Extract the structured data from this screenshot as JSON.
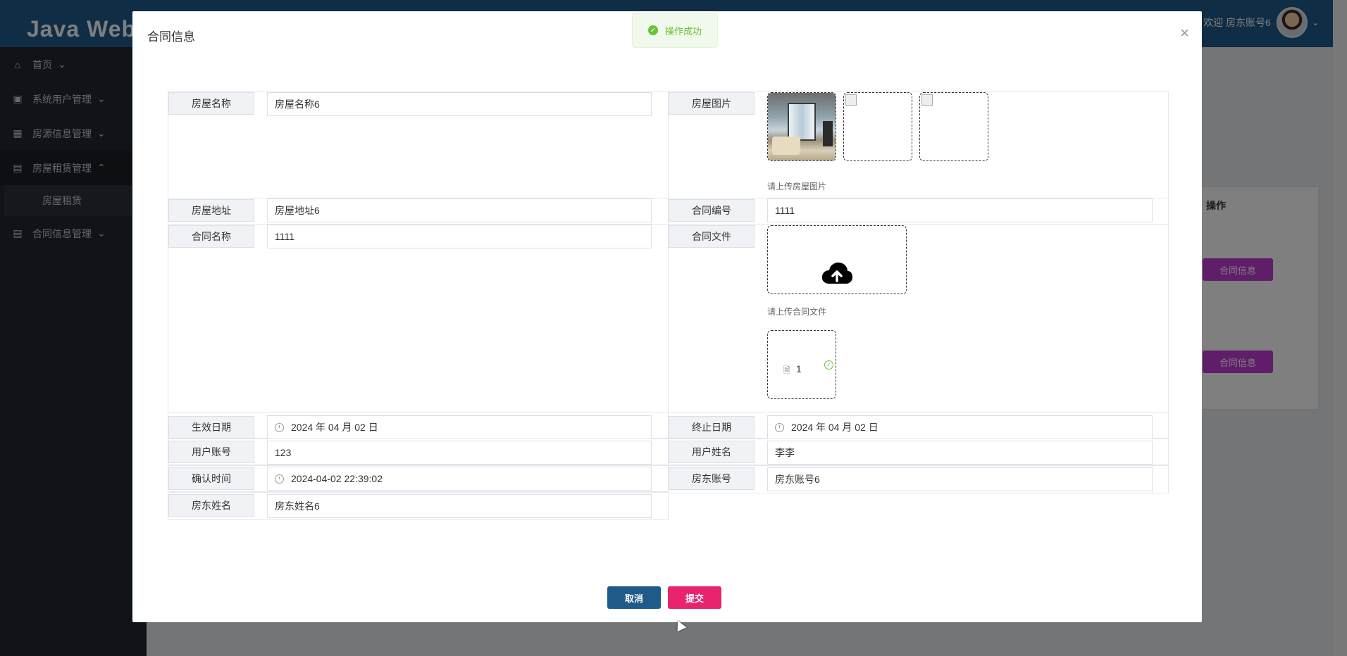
{
  "app": {
    "brand": "Java Web的",
    "welcome": "欢迎 房东账号6"
  },
  "sidebar": {
    "items": [
      {
        "icon": "home-icon",
        "glyph": "⌂",
        "label": "首页",
        "arrow": "⌄"
      },
      {
        "icon": "user-card-icon",
        "glyph": "▣",
        "label": "系统用户管理",
        "arrow": "⌄"
      },
      {
        "icon": "grid-icon",
        "glyph": "▦",
        "label": "房源信息管理",
        "arrow": "⌄"
      },
      {
        "icon": "table-icon",
        "glyph": "▤",
        "label": "房屋租赁管理",
        "arrow": "⌃"
      },
      {
        "icon": "table-icon",
        "glyph": "▤",
        "label": "合同信息管理",
        "arrow": "⌄"
      }
    ],
    "subitem": "房屋租赁"
  },
  "background": {
    "op_header": "操作",
    "row_buttons": [
      "合同信息",
      "合同信息"
    ]
  },
  "toast": {
    "text": "操作成功"
  },
  "dialog": {
    "title": "合同信息",
    "close": "×",
    "fields": {
      "house_name": {
        "label": "房屋名称",
        "value": "房屋名称6"
      },
      "house_image": {
        "label": "房屋图片",
        "hint": "请上传房屋图片"
      },
      "house_address": {
        "label": "房屋地址",
        "value": "房屋地址6"
      },
      "contract_no": {
        "label": "合同编号",
        "value": "1111"
      },
      "contract_name": {
        "label": "合同名称",
        "value": "1111"
      },
      "contract_file": {
        "label": "合同文件",
        "hint": "请上传合同文件",
        "file_name": "1"
      },
      "start_date": {
        "label": "生效日期",
        "value": "2024 年 04 月 02 日"
      },
      "end_date": {
        "label": "终止日期",
        "value": "2024 年 04 月 02 日"
      },
      "user_account": {
        "label": "用户账号",
        "value": "123"
      },
      "user_name": {
        "label": "用户姓名",
        "value": "李李"
      },
      "confirm_time": {
        "label": "确认时间",
        "value": "2024-04-02 22:39:02"
      },
      "landlord_account": {
        "label": "房东账号",
        "value": "房东账号6"
      },
      "landlord_name": {
        "label": "房东姓名",
        "value": "房东姓名6"
      }
    },
    "buttons": {
      "cancel": "取消",
      "submit": "提交"
    },
    "colors": {
      "cancel": "#1e5a8a",
      "submit": "#e8246f",
      "success": "#67c23a"
    }
  }
}
